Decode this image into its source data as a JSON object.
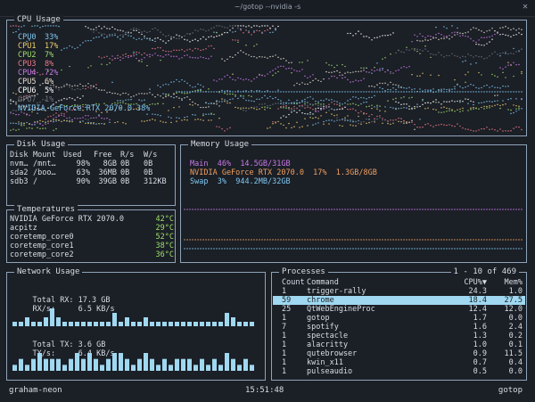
{
  "window": {
    "title": "~/gotop --nvidia -s"
  },
  "cpu": {
    "title": "CPU Usage",
    "lines": [
      {
        "label": "CPU0",
        "value": "33%",
        "color": "#7fc8f0"
      },
      {
        "label": "CPU1",
        "value": "17%",
        "color": "#f0d070"
      },
      {
        "label": "CPU2",
        "value": "7%",
        "color": "#9fe06a"
      },
      {
        "label": "CPU3",
        "value": "8%",
        "color": "#f07a8a"
      },
      {
        "label": "CPU4",
        "value": "72%",
        "color": "#c97ae8"
      },
      {
        "label": "CPU5",
        "value": "6%",
        "color": "#e8e0d0"
      },
      {
        "label": "CPU6",
        "value": "5%",
        "color": "#ffffff"
      },
      {
        "label": "CPU7",
        "value": "1%",
        "color": "#6c7380"
      }
    ],
    "gpu_line": {
      "label": "NVIDIA GeForce RTX 2070.0",
      "value": "38%",
      "color": "#7fc8f0"
    }
  },
  "disk": {
    "title": "Disk Usage",
    "headers": [
      "Disk",
      "Mount",
      "Used",
      "Free",
      "R/s",
      "W/s"
    ],
    "rows": [
      [
        "nvm…",
        "/mnt…",
        "98%",
        "8GB",
        "0B",
        "0B"
      ],
      [
        "sda2",
        "/boo…",
        "63%",
        "36MB",
        "0B",
        "0B"
      ],
      [
        "sdb3",
        "/",
        "90%",
        "39GB",
        "0B",
        "312KB"
      ]
    ]
  },
  "memory": {
    "title": "Memory Usage",
    "lines": [
      {
        "name": "Main",
        "percent": "46%",
        "amount": "14.5GB/31GB",
        "color": "#c97ae8"
      },
      {
        "name": "NVIDIA GeForce RTX 2070.0",
        "percent": "17%",
        "amount": "1.3GB/8GB",
        "color": "#f0a060"
      },
      {
        "name": "Swap",
        "percent": "3%",
        "amount": "944.2MB/32GB",
        "color": "#7fc8f0"
      }
    ]
  },
  "temps": {
    "title": "Temperatures",
    "rows": [
      {
        "name": "NVIDIA GeForce RTX 2070.0",
        "value": "42°C"
      },
      {
        "name": "acpitz",
        "value": "29°C"
      },
      {
        "name": "coretemp_core0",
        "value": "52°C"
      },
      {
        "name": "coretemp_core1",
        "value": "38°C"
      },
      {
        "name": "coretemp_core2",
        "value": "36°C"
      }
    ],
    "value_color": "#9fe06a"
  },
  "network": {
    "title": "Network Usage",
    "total_rx_label": "Total RX:",
    "total_rx": "17.3 GB",
    "rx_rate_label": "RX/s:",
    "rx_rate": "6.5 KB/s",
    "total_tx_label": "Total TX:",
    "total_tx": "3.6 GB",
    "tx_rate_label": "TX/s:",
    "tx_rate": "6.4 KB/s",
    "bar_color": "#9fd8f0"
  },
  "processes": {
    "title": "Processes",
    "range": "1 - 10 of 469",
    "headers": [
      "Count",
      "Command",
      "CPU%▼",
      "Mem%"
    ],
    "rows": [
      [
        "1",
        "trigger-rally",
        "24.3",
        "1.0"
      ],
      [
        "59",
        "chrome",
        "18.4",
        "27.5"
      ],
      [
        "25",
        "QtWebEngineProc",
        "12.4",
        "12.0"
      ],
      [
        "1",
        "gotop",
        "1.7",
        "0.0"
      ],
      [
        "7",
        "spotify",
        "1.6",
        "2.4"
      ],
      [
        "1",
        "spectacle",
        "1.3",
        "0.2"
      ],
      [
        "1",
        "alacritty",
        "1.0",
        "0.1"
      ],
      [
        "1",
        "qutebrowser",
        "0.9",
        "11.5"
      ],
      [
        "1",
        "kwin_x11",
        "0.7",
        "0.4"
      ],
      [
        "1",
        "pulseaudio",
        "0.5",
        "0.0"
      ]
    ],
    "selected_index": 1,
    "selected_color": "#9fd8f0"
  },
  "statusbar": {
    "host": "graham-neon",
    "time": "15:51:48",
    "app": "gotop"
  }
}
